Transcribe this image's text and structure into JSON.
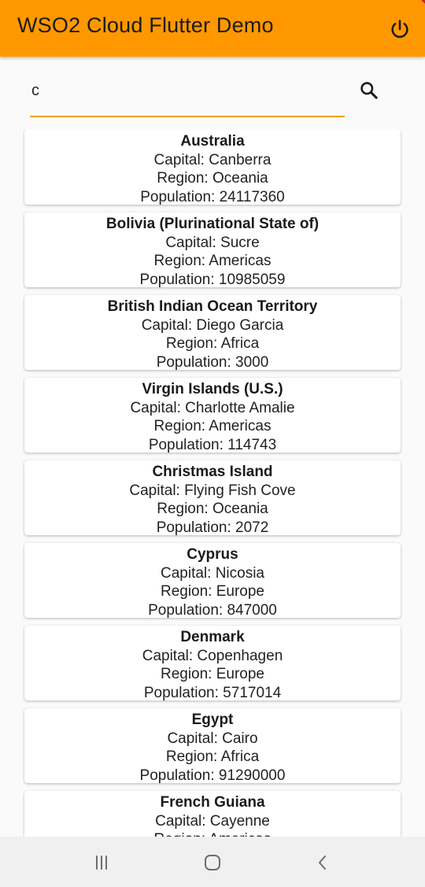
{
  "appbar": {
    "title": "WSO2 Cloud Flutter Demo",
    "color": "#ff9800",
    "power_icon": "power-icon"
  },
  "search": {
    "value": "c",
    "search_icon": "search-icon",
    "underline_color": "#f0a020"
  },
  "countries": [
    {
      "name": "Australia",
      "capital": "Capital: Canberra",
      "region": "Region: Oceania",
      "population": "Population: 24117360"
    },
    {
      "name": "Bolivia (Plurinational State of)",
      "capital": "Capital: Sucre",
      "region": "Region: Americas",
      "population": "Population: 10985059"
    },
    {
      "name": "British Indian Ocean Territory",
      "capital": "Capital: Diego Garcia",
      "region": "Region: Africa",
      "population": "Population: 3000"
    },
    {
      "name": "Virgin Islands (U.S.)",
      "capital": "Capital: Charlotte Amalie",
      "region": "Region: Americas",
      "population": "Population: 114743"
    },
    {
      "name": "Christmas Island",
      "capital": "Capital: Flying Fish Cove",
      "region": "Region: Oceania",
      "population": "Population: 2072"
    },
    {
      "name": "Cyprus",
      "capital": "Capital: Nicosia",
      "region": "Region: Europe",
      "population": "Population: 847000"
    },
    {
      "name": "Denmark",
      "capital": "Capital: Copenhagen",
      "region": "Region: Europe",
      "population": "Population: 5717014"
    },
    {
      "name": "Egypt",
      "capital": "Capital: Cairo",
      "region": "Region: Africa",
      "population": "Population: 91290000"
    },
    {
      "name": "French Guiana",
      "capital": "Capital: Cayenne",
      "region": "Region: Americas",
      "population": ""
    }
  ],
  "navbar": {
    "recents_icon": "recents-icon",
    "home_icon": "home-icon",
    "back_icon": "back-icon"
  }
}
